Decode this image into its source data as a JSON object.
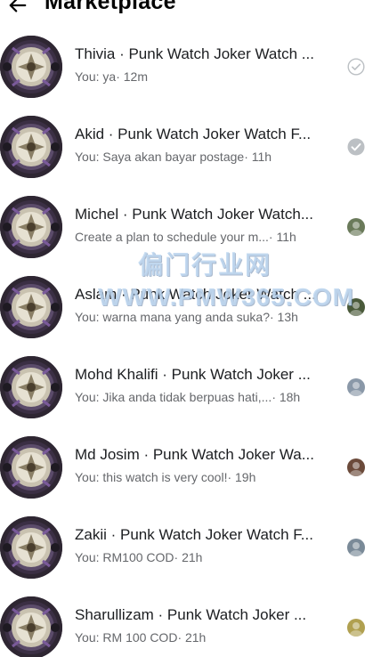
{
  "header": {
    "title": "Marketplace",
    "back_icon": "arrow-left-icon"
  },
  "threads": [
    {
      "title": "Thivia · Punk Watch Joker Watch ...",
      "snippet": "You: ya",
      "time": " · 12m",
      "indicator": "sent-check-outline",
      "indicator_color": "#bcc0c4"
    },
    {
      "title": "Akid · Punk Watch Joker Watch F...",
      "snippet": "You: Saya akan bayar postage",
      "time": " · 11h",
      "indicator": "delivered-check-filled",
      "indicator_color": "#bcc0c4"
    },
    {
      "title": "Michel · Punk Watch Joker Watch...",
      "snippet": "Create a plan to schedule your m...",
      "time": " · 11h",
      "indicator": "seen-avatar",
      "indicator_color": "#6a7a5a"
    },
    {
      "title": "Aslam · Punk Watch Joker Watch ...",
      "snippet": "You: warna mana yang anda suka?",
      "time": " · 13h",
      "indicator": "seen-avatar",
      "indicator_color": "#4a5a3a"
    },
    {
      "title": "Mohd Khalifi · Punk Watch Joker ...",
      "snippet": "You: Jika anda tidak berpuas hati,...",
      "time": " · 18h",
      "indicator": "seen-avatar",
      "indicator_color": "#8a98a8"
    },
    {
      "title": "Md Josim · Punk Watch Joker Wa...",
      "snippet": "You: this watch is very cool!",
      "time": " · 19h",
      "indicator": "seen-avatar",
      "indicator_color": "#6b4a3a"
    },
    {
      "title": "Zakii · Punk Watch Joker Watch F...",
      "snippet": "You: RM100 COD",
      "time": " · 21h",
      "indicator": "seen-avatar",
      "indicator_color": "#7a8a98"
    },
    {
      "title": "Sharullizam · Punk Watch Joker ...",
      "snippet": "You: RM 100 COD",
      "time": " · 21h",
      "indicator": "seen-avatar",
      "indicator_color": "#b0a050"
    }
  ],
  "watermark": {
    "line1": "偏门行业网",
    "line2": "WWW.PMW365.COM"
  },
  "colors": {
    "title_text": "#1c1e21",
    "secondary_text": "#65676b",
    "avatar_bg": "#2b2530"
  }
}
